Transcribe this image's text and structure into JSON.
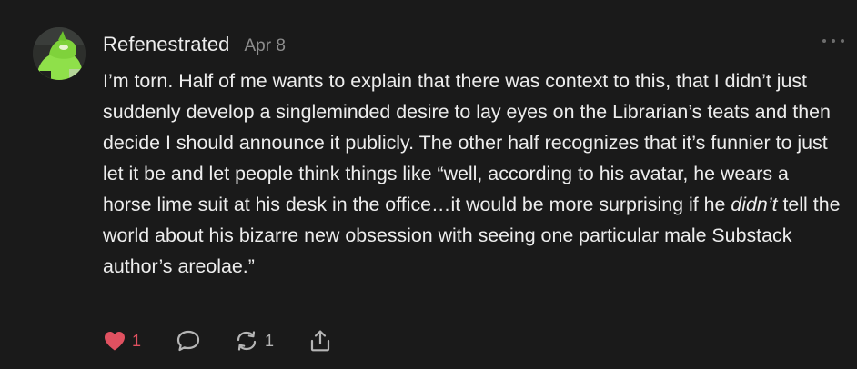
{
  "comment": {
    "author": "Refenestrated",
    "date": "Apr 8",
    "avatar_icon": "avatar-image",
    "body_parts": {
      "p1": "I’m torn. Half of me wants to explain that there was context to this, that I didn’t just suddenly develop a singleminded desire to lay eyes on the Librarian’s teats and then decide I should announce it publicly. The other half recognizes that it’s funnier to just let it be and let people think things like “well, according to his avatar, he wears a horse lime suit at his desk in the office…it would be more surprising if he ",
      "em": "didn’t",
      "p2": " tell the world about his bizarre new obsession with seeing one particular male Substack author’s areolae.”"
    },
    "actions": {
      "like_icon": "heart-icon",
      "like_count": "1",
      "reply_icon": "comment-bubble-icon",
      "restack_icon": "restack-icon",
      "restack_count": "1",
      "share_icon": "share-icon"
    },
    "more_icon": "more-options-icon"
  },
  "colors": {
    "background": "#1a1a1a",
    "text": "#ededed",
    "muted": "#8d8d8d",
    "like": "#e05160",
    "avatar_green": "#8fe04a"
  }
}
